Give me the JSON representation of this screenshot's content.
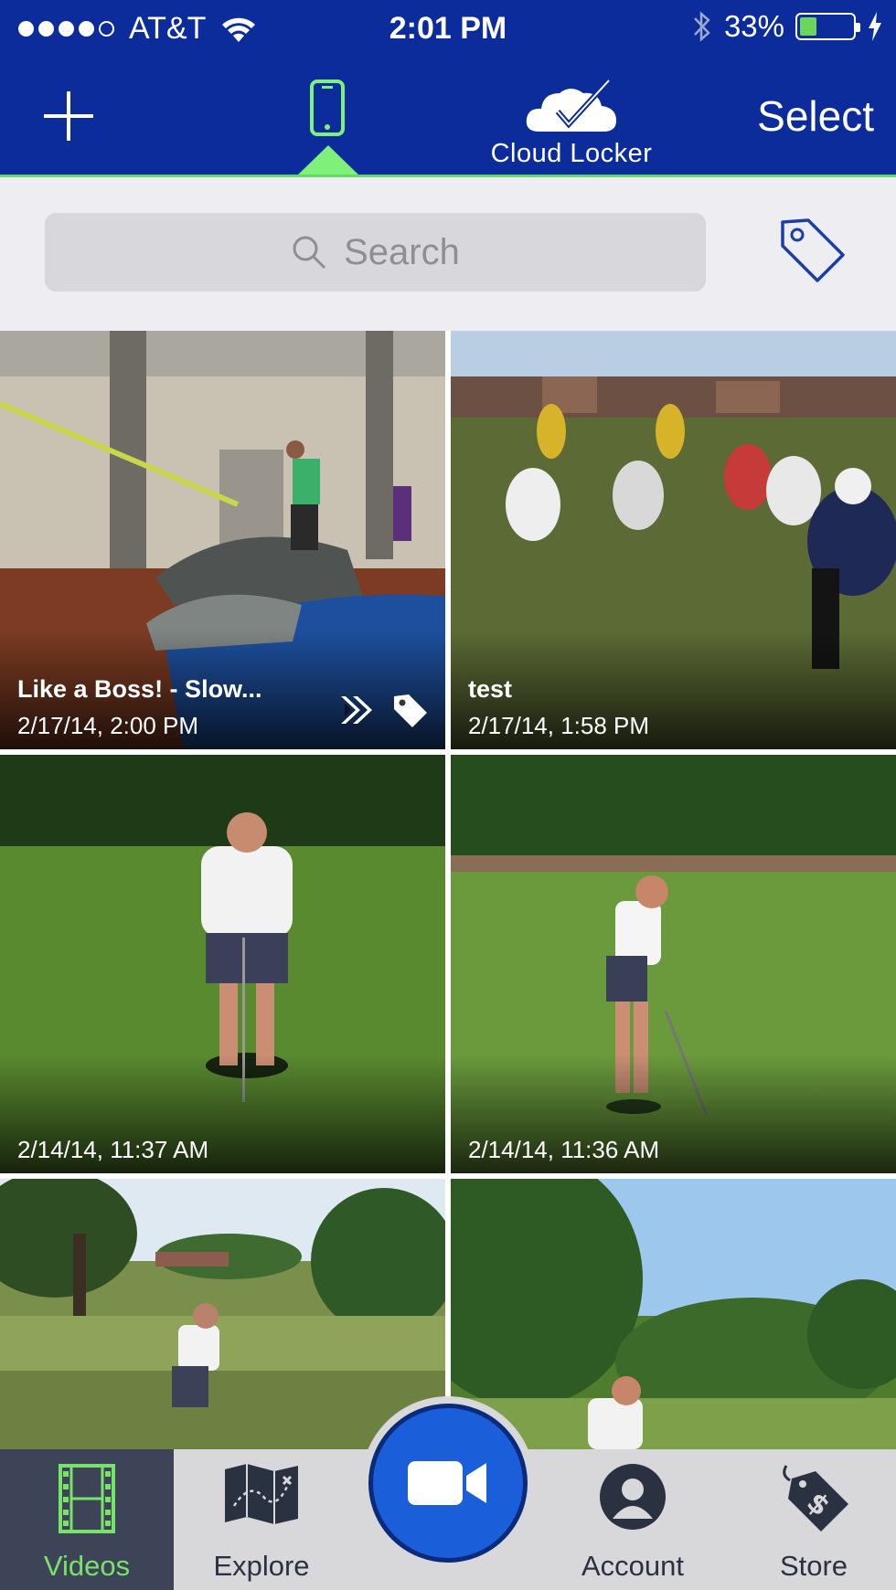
{
  "status_bar": {
    "carrier": "AT&T",
    "time": "2:01 PM",
    "battery": "33%",
    "signal_icon": "signal-dots-icon",
    "wifi_icon": "wifi-icon",
    "bluetooth_icon": "bluetooth-icon"
  },
  "nav": {
    "add_icon": "plus-icon",
    "device_icon": "phone-icon",
    "cloud_label": "Cloud Locker",
    "select_label": "Select"
  },
  "search": {
    "placeholder": "Search"
  },
  "videos": [
    {
      "title": "Like a Boss! - Slow...",
      "date": "2/17/14, 2:00 PM",
      "icons": [
        "slow-motion-icon",
        "tag-icon"
      ]
    },
    {
      "title": "test",
      "date": "2/17/14, 1:58 PM",
      "icons": []
    },
    {
      "title": "",
      "date": "2/14/14, 11:37 AM",
      "icons": []
    },
    {
      "title": "",
      "date": "2/14/14, 11:36 AM",
      "icons": []
    },
    {
      "title": "",
      "date": "",
      "icons": []
    },
    {
      "title": "",
      "date": "",
      "icons": []
    }
  ],
  "tabbar": {
    "videos": "Videos",
    "explore": "Explore",
    "record_icon": "video-camera-icon",
    "account": "Account",
    "store": "Store"
  },
  "colors": {
    "header_blue": "#0b2c9a",
    "accent_green": "#7ff07a",
    "record_blue": "#1b5ed9"
  }
}
